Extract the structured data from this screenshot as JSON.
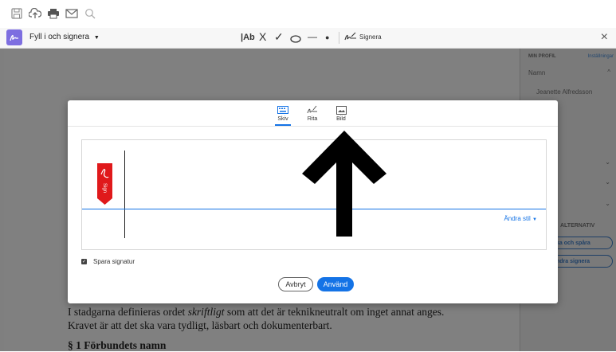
{
  "toolbar": {
    "icons": [
      "save-icon",
      "upload-icon",
      "print-icon",
      "mail-icon",
      "search-icon"
    ]
  },
  "fill_sign": {
    "label": "Fyll i och signera",
    "tools": {
      "text": "|Ab",
      "cross": "X",
      "check": "✓",
      "dash": "—",
      "dot": "●",
      "sign": "Signera"
    },
    "close": "×"
  },
  "document": {
    "line1_a": "I stadgarna definieras ordet ",
    "line1_em": "skriftligt",
    "line1_b": " som att det är teknikneutralt om inget annat anges.",
    "line2": "Kravet är att det ska vara tydligt, läsbart och dokumenterbart.",
    "heading": "§ 1 Förbundets namn"
  },
  "right_panel": {
    "my_profile": "MIN PROFIL",
    "settings": "Inställningar",
    "name_label": "Namn",
    "name_value": "Jeanette Alfredsson",
    "alt_partial": "ALTERNATIV",
    "btn1_partial": "ka och spåra",
    "btn2_partial": "ndra signera"
  },
  "modal": {
    "tabs": [
      {
        "label": "Skiv",
        "icon": "keyboard-icon",
        "active": true
      },
      {
        "label": "Rita",
        "icon": "draw-pen-icon",
        "active": false
      },
      {
        "label": "Bild",
        "icon": "image-icon",
        "active": false
      }
    ],
    "change_style": "Ändra stil",
    "save_signature": "Spara signatur",
    "save_checked": true,
    "cancel": "Avbryt",
    "apply": "Använd",
    "sign_flag_text": "Sign"
  },
  "colors": {
    "accent_blue": "#1473e6",
    "adobe_red": "#e0191b",
    "fill_sign_purple": "#7d6ee0"
  }
}
